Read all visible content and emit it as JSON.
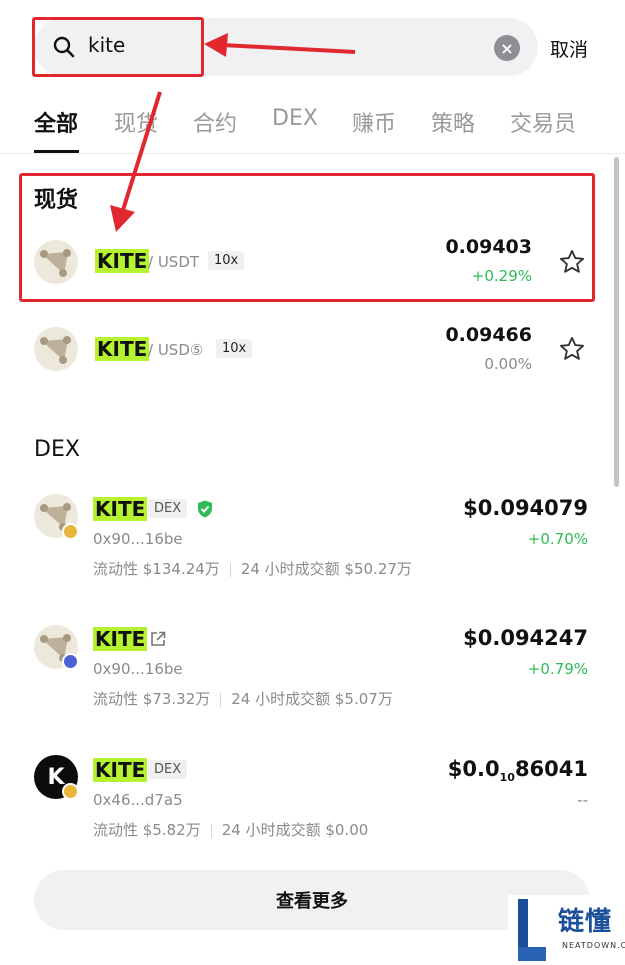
{
  "search": {
    "query": "kite",
    "cancel_label": "取消"
  },
  "tabs": [
    {
      "label": "全部",
      "active": true
    },
    {
      "label": "现货",
      "active": false
    },
    {
      "label": "合约",
      "active": false
    },
    {
      "label": "DEX",
      "active": false
    },
    {
      "label": "赚币",
      "active": false
    },
    {
      "label": "策略",
      "active": false
    },
    {
      "label": "交易员",
      "active": false
    }
  ],
  "spot": {
    "section_title": "现货",
    "items": [
      {
        "ticker": "KITE",
        "pair": "/ USDT",
        "leverage": "10x",
        "price": "0.09403",
        "change": "+0.29%"
      },
      {
        "ticker": "KITE",
        "pair": "/ USD⑤",
        "leverage": "10x",
        "price": "0.09466",
        "change": "0.00%"
      }
    ]
  },
  "dex": {
    "section_title": "DEX",
    "items": [
      {
        "ticker": "KITE",
        "badge": "DEX",
        "address": "0x90...16be",
        "liquidity": "流动性 $134.24万",
        "volume": "24 小时成交额 $50.27万",
        "price": "$0.094079",
        "change": "+0.70%"
      },
      {
        "ticker": "KITE",
        "address": "0x90...16be",
        "liquidity": "流动性 $73.32万",
        "volume": "24 小时成交额 $5.07万",
        "price": "$0.094247",
        "change": "+0.79%"
      },
      {
        "ticker": "KITE",
        "badge": "DEX",
        "logo_letter": "K",
        "address": "0x46...d7a5",
        "liquidity": "流动性 $5.82万",
        "volume": "24 小时成交额 $0.00",
        "price_main": "$0.0",
        "price_sub": "10",
        "price_rest": "86041",
        "change": "--"
      }
    ]
  },
  "more_label": "查看更多",
  "watermark": {
    "text": "链懂",
    "sub": "NEATDOWN.COM"
  },
  "colors": {
    "accent_up": "#2fb957",
    "highlight": "#b5f230",
    "annotation": "#e0282e"
  }
}
